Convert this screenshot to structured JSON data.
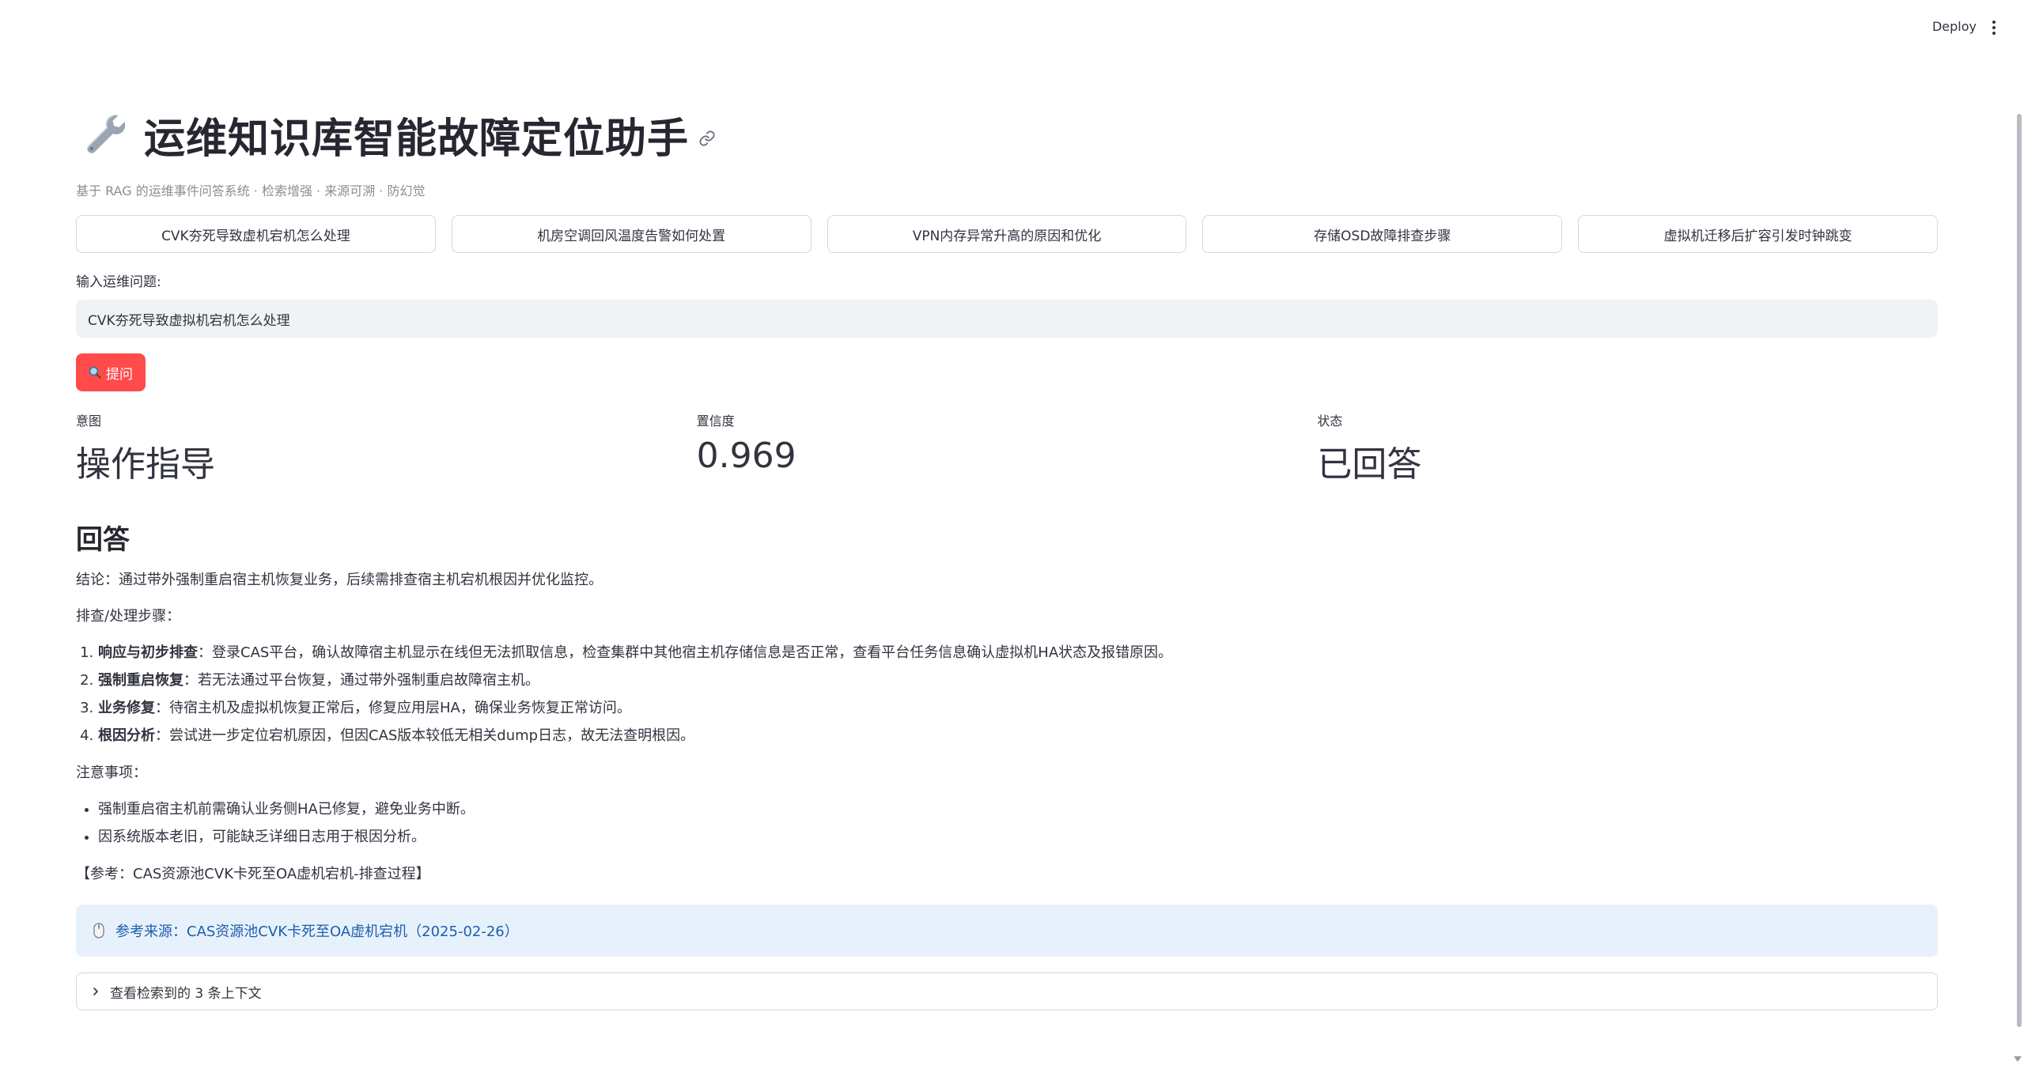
{
  "topbar": {
    "deploy_label": "Deploy"
  },
  "header": {
    "title": "运维知识库智能故障定位助手",
    "subtitle": "基于 RAG 的运维事件问答系统 · 检索增强 · 来源可溯 · 防幻觉"
  },
  "quick_questions": [
    "CVK夯死导致虚机宕机怎么处理",
    "机房空调回风温度告警如何处置",
    "VPN内存异常升高的原因和优化",
    "存储OSD故障排查步骤",
    "虚拟机迁移后扩容引发时钟跳变"
  ],
  "query": {
    "label": "输入运维问题:",
    "value": "CVK夯死导致虚拟机宕机怎么处理"
  },
  "ask_button": {
    "label": "提问"
  },
  "metrics": [
    {
      "label": "意图",
      "value": "操作指导"
    },
    {
      "label": "置信度",
      "value": "0.969"
    },
    {
      "label": "状态",
      "value": "已回答"
    }
  ],
  "answer": {
    "heading": "回答",
    "conclusion": "结论：通过带外强制重启宿主机恢复业务，后续需排查宿主机宕机根因并优化监控。",
    "steps_title": "排查/处理步骤：",
    "steps": [
      {
        "bold": "响应与初步排查",
        "text": "：登录CAS平台，确认故障宿主机显示在线但无法抓取信息，检查集群中其他宿主机存储信息是否正常，查看平台任务信息确认虚拟机HA状态及报错原因。"
      },
      {
        "bold": "强制重启恢复",
        "text": "：若无法通过平台恢复，通过带外强制重启故障宿主机。"
      },
      {
        "bold": "业务修复",
        "text": "：待宿主机及虚拟机恢复正常后，修复应用层HA，确保业务恢复正常访问。"
      },
      {
        "bold": "根因分析",
        "text": "：尝试进一步定位宕机原因，但因CAS版本较低无相关dump日志，故无法查明根因。"
      }
    ],
    "notes_title": "注意事项：",
    "notes": [
      "强制重启宿主机前需确认业务侧HA已修复，避免业务中断。",
      "因系统版本老旧，可能缺乏详细日志用于根因分析。"
    ],
    "reference": "【参考：CAS资源池CVK卡死至OA虚机宕机-排查过程】"
  },
  "source": {
    "label": "参考来源",
    "separator": "：",
    "link_text": "CAS资源池CVK卡死至OA虚机宕机（2025-02-26）"
  },
  "expander": {
    "label": "查看检索到的 3 条上下文"
  },
  "colors": {
    "primary": "#ff4b4b",
    "info_bg": "#e7f1fc",
    "info_text": "#1b5faa"
  }
}
